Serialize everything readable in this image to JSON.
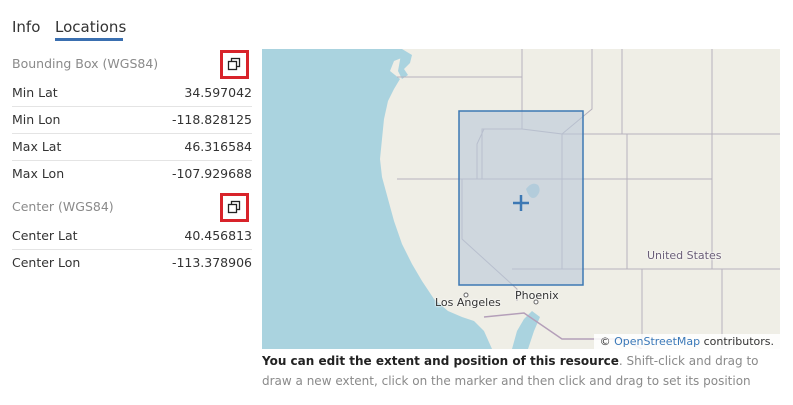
{
  "tabs": {
    "info": "Info",
    "locations": "Locations"
  },
  "bounding_box": {
    "title": "Bounding Box (WGS84)",
    "rows": [
      {
        "label": "Min Lat",
        "value": "34.597042"
      },
      {
        "label": "Min Lon",
        "value": "-118.828125"
      },
      {
        "label": "Max Lat",
        "value": "46.316584"
      },
      {
        "label": "Max Lon",
        "value": "-107.929688"
      }
    ]
  },
  "center": {
    "title": "Center (WGS84)",
    "rows": [
      {
        "label": "Center Lat",
        "value": "40.456813"
      },
      {
        "label": "Center Lon",
        "value": "-113.378906"
      }
    ]
  },
  "map": {
    "labels": {
      "los_angeles": "Los Angeles",
      "phoenix": "Phoenix",
      "united_states": "United States"
    },
    "attribution_prefix": "©",
    "attribution_link": "OpenStreetMap",
    "attribution_suffix": "contributors.",
    "colors": {
      "water": "#aad3df",
      "land": "#efeee6",
      "extent_fill": "#b9c8d8",
      "extent_stroke": "#3d78b4"
    }
  },
  "help": {
    "bold": "You can edit the extent and position of this resource",
    "rest": ". Shift-click and drag to draw a new extent, click on the marker and then click and drag to set its position"
  },
  "icons": {
    "copy": "copy-icon",
    "marker": "crosshair-marker-icon"
  },
  "accent": "#3a6fb0"
}
